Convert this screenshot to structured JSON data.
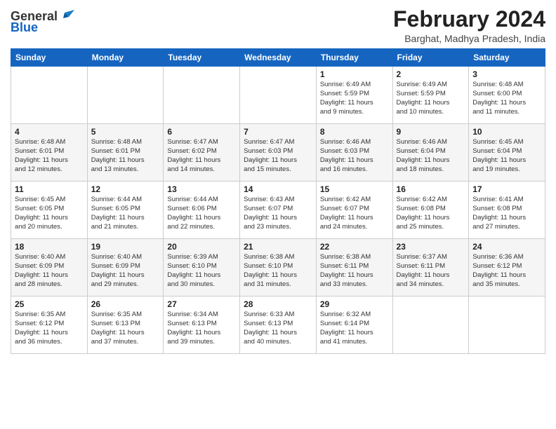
{
  "header": {
    "logo_line1": "General",
    "logo_line2": "Blue",
    "month_year": "February 2024",
    "location": "Barghat, Madhya Pradesh, India"
  },
  "weekdays": [
    "Sunday",
    "Monday",
    "Tuesday",
    "Wednesday",
    "Thursday",
    "Friday",
    "Saturday"
  ],
  "weeks": [
    [
      {
        "day": "",
        "info": ""
      },
      {
        "day": "",
        "info": ""
      },
      {
        "day": "",
        "info": ""
      },
      {
        "day": "",
        "info": ""
      },
      {
        "day": "1",
        "info": "Sunrise: 6:49 AM\nSunset: 5:59 PM\nDaylight: 11 hours\nand 9 minutes."
      },
      {
        "day": "2",
        "info": "Sunrise: 6:49 AM\nSunset: 5:59 PM\nDaylight: 11 hours\nand 10 minutes."
      },
      {
        "day": "3",
        "info": "Sunrise: 6:48 AM\nSunset: 6:00 PM\nDaylight: 11 hours\nand 11 minutes."
      }
    ],
    [
      {
        "day": "4",
        "info": "Sunrise: 6:48 AM\nSunset: 6:01 PM\nDaylight: 11 hours\nand 12 minutes."
      },
      {
        "day": "5",
        "info": "Sunrise: 6:48 AM\nSunset: 6:01 PM\nDaylight: 11 hours\nand 13 minutes."
      },
      {
        "day": "6",
        "info": "Sunrise: 6:47 AM\nSunset: 6:02 PM\nDaylight: 11 hours\nand 14 minutes."
      },
      {
        "day": "7",
        "info": "Sunrise: 6:47 AM\nSunset: 6:03 PM\nDaylight: 11 hours\nand 15 minutes."
      },
      {
        "day": "8",
        "info": "Sunrise: 6:46 AM\nSunset: 6:03 PM\nDaylight: 11 hours\nand 16 minutes."
      },
      {
        "day": "9",
        "info": "Sunrise: 6:46 AM\nSunset: 6:04 PM\nDaylight: 11 hours\nand 18 minutes."
      },
      {
        "day": "10",
        "info": "Sunrise: 6:45 AM\nSunset: 6:04 PM\nDaylight: 11 hours\nand 19 minutes."
      }
    ],
    [
      {
        "day": "11",
        "info": "Sunrise: 6:45 AM\nSunset: 6:05 PM\nDaylight: 11 hours\nand 20 minutes."
      },
      {
        "day": "12",
        "info": "Sunrise: 6:44 AM\nSunset: 6:05 PM\nDaylight: 11 hours\nand 21 minutes."
      },
      {
        "day": "13",
        "info": "Sunrise: 6:44 AM\nSunset: 6:06 PM\nDaylight: 11 hours\nand 22 minutes."
      },
      {
        "day": "14",
        "info": "Sunrise: 6:43 AM\nSunset: 6:07 PM\nDaylight: 11 hours\nand 23 minutes."
      },
      {
        "day": "15",
        "info": "Sunrise: 6:42 AM\nSunset: 6:07 PM\nDaylight: 11 hours\nand 24 minutes."
      },
      {
        "day": "16",
        "info": "Sunrise: 6:42 AM\nSunset: 6:08 PM\nDaylight: 11 hours\nand 25 minutes."
      },
      {
        "day": "17",
        "info": "Sunrise: 6:41 AM\nSunset: 6:08 PM\nDaylight: 11 hours\nand 27 minutes."
      }
    ],
    [
      {
        "day": "18",
        "info": "Sunrise: 6:40 AM\nSunset: 6:09 PM\nDaylight: 11 hours\nand 28 minutes."
      },
      {
        "day": "19",
        "info": "Sunrise: 6:40 AM\nSunset: 6:09 PM\nDaylight: 11 hours\nand 29 minutes."
      },
      {
        "day": "20",
        "info": "Sunrise: 6:39 AM\nSunset: 6:10 PM\nDaylight: 11 hours\nand 30 minutes."
      },
      {
        "day": "21",
        "info": "Sunrise: 6:38 AM\nSunset: 6:10 PM\nDaylight: 11 hours\nand 31 minutes."
      },
      {
        "day": "22",
        "info": "Sunrise: 6:38 AM\nSunset: 6:11 PM\nDaylight: 11 hours\nand 33 minutes."
      },
      {
        "day": "23",
        "info": "Sunrise: 6:37 AM\nSunset: 6:11 PM\nDaylight: 11 hours\nand 34 minutes."
      },
      {
        "day": "24",
        "info": "Sunrise: 6:36 AM\nSunset: 6:12 PM\nDaylight: 11 hours\nand 35 minutes."
      }
    ],
    [
      {
        "day": "25",
        "info": "Sunrise: 6:35 AM\nSunset: 6:12 PM\nDaylight: 11 hours\nand 36 minutes."
      },
      {
        "day": "26",
        "info": "Sunrise: 6:35 AM\nSunset: 6:13 PM\nDaylight: 11 hours\nand 37 minutes."
      },
      {
        "day": "27",
        "info": "Sunrise: 6:34 AM\nSunset: 6:13 PM\nDaylight: 11 hours\nand 39 minutes."
      },
      {
        "day": "28",
        "info": "Sunrise: 6:33 AM\nSunset: 6:13 PM\nDaylight: 11 hours\nand 40 minutes."
      },
      {
        "day": "29",
        "info": "Sunrise: 6:32 AM\nSunset: 6:14 PM\nDaylight: 11 hours\nand 41 minutes."
      },
      {
        "day": "",
        "info": ""
      },
      {
        "day": "",
        "info": ""
      }
    ]
  ]
}
